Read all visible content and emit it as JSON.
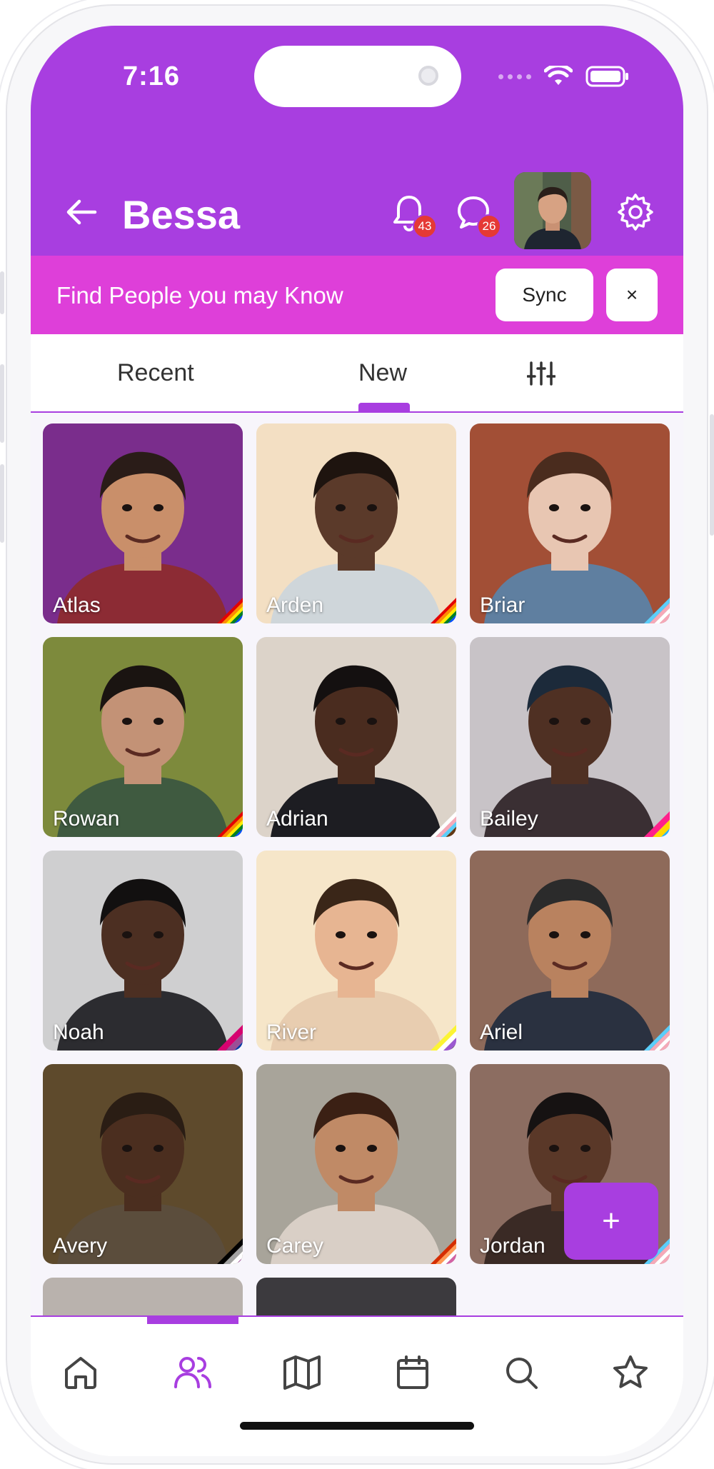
{
  "status_bar": {
    "time": "7:16"
  },
  "header": {
    "title": "Bessa",
    "notifications_count": "43",
    "messages_count": "26"
  },
  "banner": {
    "text": "Find People you may Know",
    "sync_label": "Sync",
    "close_label": "×"
  },
  "tabs": [
    {
      "label": "Recent"
    },
    {
      "label": "New",
      "active": true
    }
  ],
  "profiles": [
    {
      "name": "Atlas",
      "bg": "#7a2d8c",
      "shirt": "#8c2b34",
      "skin": "#c98f6a",
      "hair": "#2a1c18",
      "flag": "rainbow"
    },
    {
      "name": "Arden",
      "bg": "#f3dfc3",
      "shirt": "#cfd6da",
      "skin": "#5b3a2a",
      "hair": "#1e140f",
      "flag": "rainbow"
    },
    {
      "name": "Briar",
      "bg": "#a24f36",
      "shirt": "#5f7fa0",
      "skin": "#e8c6b2",
      "hair": "#4a2c1e",
      "flag": "trans"
    },
    {
      "name": "Rowan",
      "bg": "#7d8a3c",
      "shirt": "#3f5a40",
      "skin": "#c39276",
      "hair": "#1a1411",
      "flag": "rainbow"
    },
    {
      "name": "Adrian",
      "bg": "#dcd3c9",
      "shirt": "#1d1d22",
      "skin": "#4a2c1f",
      "hair": "#141010",
      "flag": "progress"
    },
    {
      "name": "Bailey",
      "bg": "#c8c3c7",
      "shirt": "#3a2f33",
      "skin": "#4f3023",
      "hair": "#1c2a3a",
      "flag": "pan"
    },
    {
      "name": "Noah",
      "bg": "#cfcfd0",
      "shirt": "#2c2c30",
      "skin": "#4c2f22",
      "hair": "#121010",
      "flag": "bi"
    },
    {
      "name": "River",
      "bg": "#f6e6c9",
      "shirt": "#e8cdb0",
      "skin": "#e7b592",
      "hair": "#3a2618",
      "flag": "nonbinary"
    },
    {
      "name": "Ariel",
      "bg": "#8e6a5a",
      "shirt": "#2a3140",
      "skin": "#b9825f",
      "hair": "#2b2b2b",
      "flag": "trans"
    },
    {
      "name": "Avery",
      "bg": "#5e4a2c",
      "shirt": "#5b4d3c",
      "skin": "#4b2e1f",
      "hair": "#2a1d14",
      "flag": "ace"
    },
    {
      "name": "Carey",
      "bg": "#a8a49a",
      "shirt": "#d9cfc6",
      "skin": "#c08a66",
      "hair": "#3b2014",
      "flag": "lesbian"
    },
    {
      "name": "Jordan",
      "bg": "#8c6d61",
      "shirt": "#3a2a25",
      "skin": "#5a3828",
      "hair": "#161212",
      "flag": "trans"
    }
  ],
  "fab": {
    "label": "+"
  },
  "bottom_nav": [
    {
      "icon": "home-icon"
    },
    {
      "icon": "people-icon",
      "active": true
    },
    {
      "icon": "map-icon"
    },
    {
      "icon": "calendar-icon"
    },
    {
      "icon": "search-icon"
    },
    {
      "icon": "star-icon"
    }
  ],
  "colors": {
    "primary": "#a83ee0",
    "banner": "#de3fd9",
    "badge": "#e53935"
  }
}
